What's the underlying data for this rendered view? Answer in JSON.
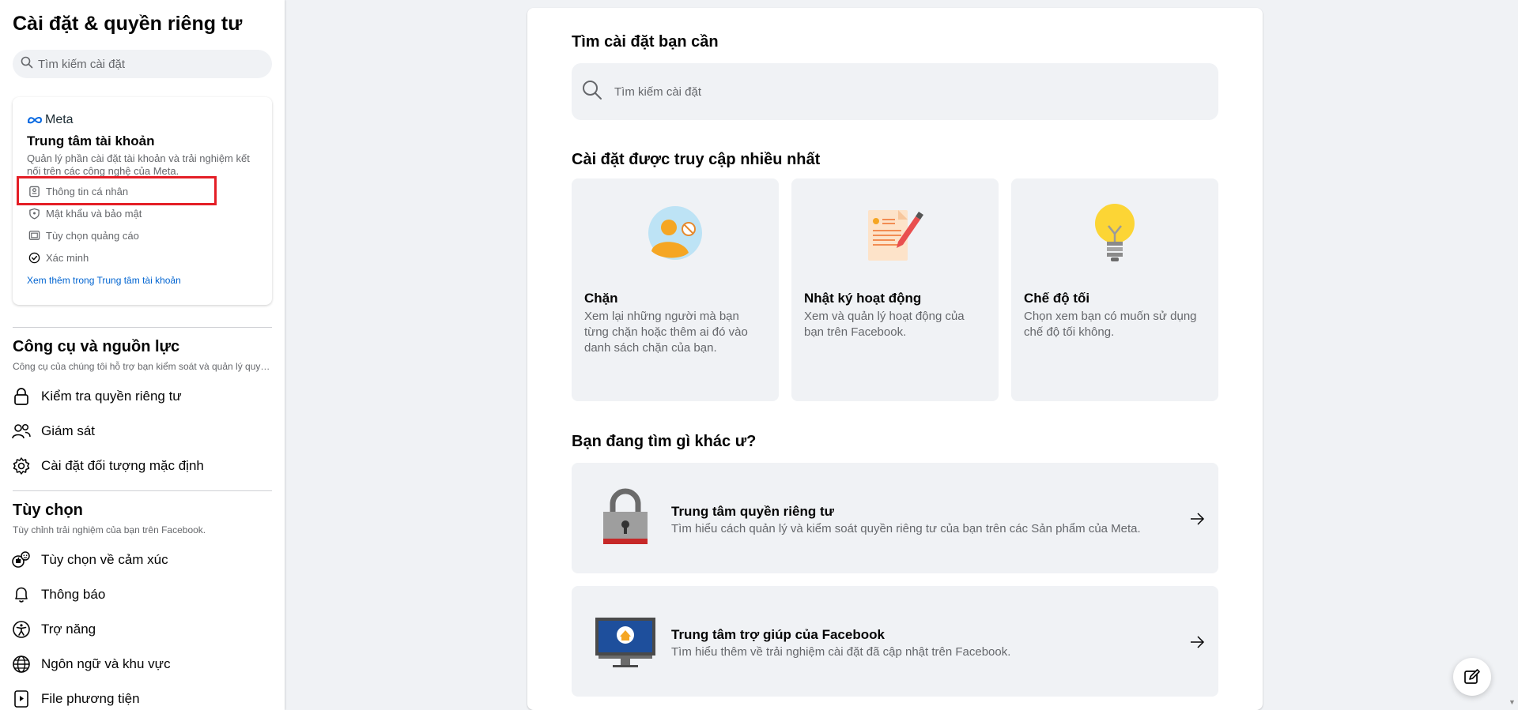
{
  "sidebar": {
    "title": "Cài đặt & quyền riêng tư",
    "search_placeholder": "Tìm kiếm cài đặt",
    "meta_card": {
      "logo_text": "Meta",
      "title": "Trung tâm tài khoản",
      "description": "Quản lý phần cài đặt tài khoản và trải nghiệm kết nối trên các công nghệ của Meta.",
      "items": [
        {
          "label": "Thông tin cá nhân",
          "icon": "id-card-icon"
        },
        {
          "label": "Mật khẩu và bảo mật",
          "icon": "shield-icon"
        },
        {
          "label": "Tùy chọn quảng cáo",
          "icon": "monitor-icon"
        },
        {
          "label": "Xác minh",
          "icon": "verified-check-icon"
        }
      ],
      "see_more": "Xem thêm trong Trung tâm tài khoản"
    },
    "tools_section": {
      "title": "Công cụ và nguồn lực",
      "subtitle": "Công cụ của chúng tôi hỗ trợ bạn kiểm soát và quản lý quyền riêng tư của mình.",
      "items": [
        {
          "label": "Kiểm tra quyền riêng tư",
          "icon": "lock-icon"
        },
        {
          "label": "Giám sát",
          "icon": "people-icon"
        },
        {
          "label": "Cài đặt đối tượng mặc định",
          "icon": "gear-icon"
        }
      ]
    },
    "options_section": {
      "title": "Tùy chọn",
      "subtitle": "Tùy chỉnh trải nghiệm của bạn trên Facebook.",
      "items": [
        {
          "label": "Tùy chọn về cảm xúc",
          "icon": "reactions-icon"
        },
        {
          "label": "Thông báo",
          "icon": "bell-icon"
        },
        {
          "label": "Trợ năng",
          "icon": "accessibility-icon"
        },
        {
          "label": "Ngôn ngữ và khu vực",
          "icon": "globe-icon"
        },
        {
          "label": "File phương tiện",
          "icon": "media-file-icon"
        }
      ]
    }
  },
  "main": {
    "search_heading": "Tìm cài đặt bạn cần",
    "search_placeholder": "Tìm kiếm cài đặt",
    "most_visited_heading": "Cài đặt được truy cập nhiều nhất",
    "cards": [
      {
        "title": "Chặn",
        "description": "Xem lại những người mà bạn từng chặn hoặc thêm ai đó vào danh sách chặn của bạn."
      },
      {
        "title": "Nhật ký hoạt động",
        "description": "Xem và quản lý hoạt động của bạn trên Facebook."
      },
      {
        "title": "Chế độ tối",
        "description": "Chọn xem bạn có muốn sử dụng chế độ tối không."
      }
    ],
    "other_heading": "Bạn đang tìm gì khác ư?",
    "links": [
      {
        "title": "Trung tâm quyền riêng tư",
        "description": "Tìm hiểu cách quản lý và kiểm soát quyền riêng tư của bạn trên các Sản phẩm của Meta."
      },
      {
        "title": "Trung tâm trợ giúp của Facebook",
        "description": "Tìm hiểu thêm về trải nghiệm cài đặt đã cập nhật trên Facebook."
      }
    ]
  },
  "colors": {
    "highlight": "#e41e26",
    "link": "#0064d1",
    "panel_bg": "#f0f2f5"
  }
}
